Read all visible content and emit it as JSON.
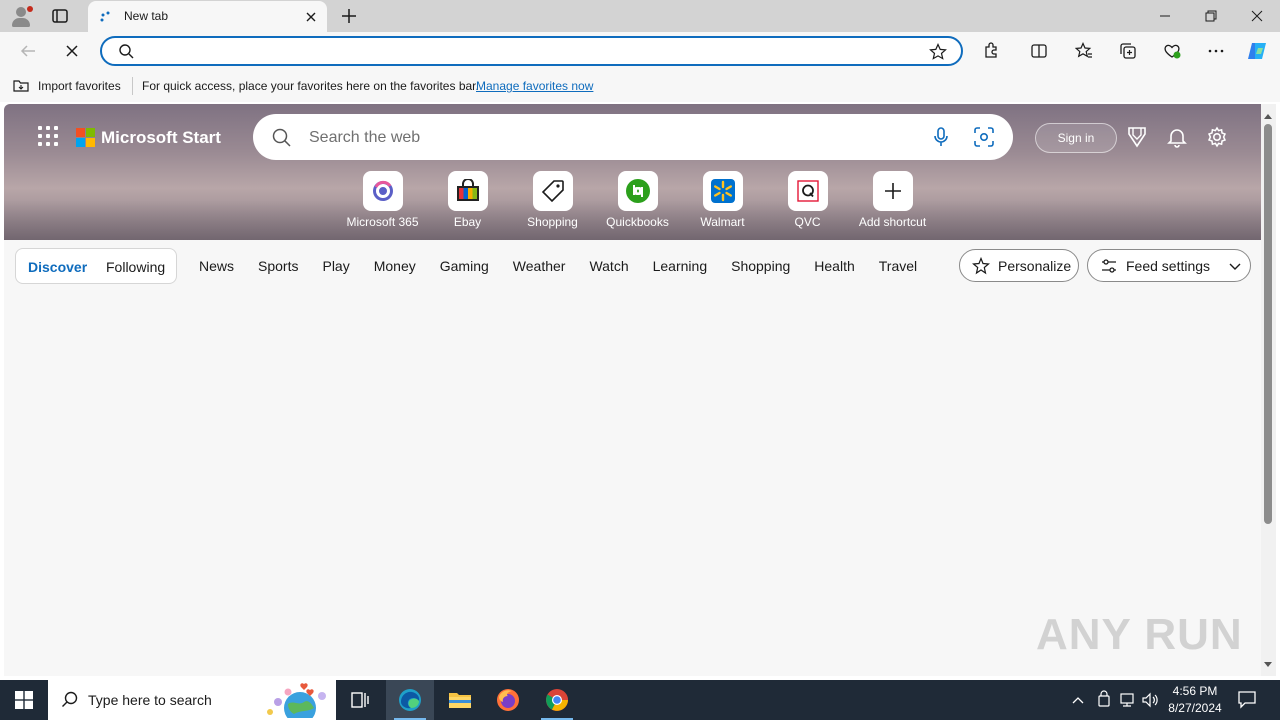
{
  "browser": {
    "tab_title": "New tab",
    "address_value": "",
    "favorites_bar": {
      "import_label": "Import favorites",
      "message": "For quick access, place your favorites here on the favorites bar.",
      "manage_link": "Manage favorites now"
    }
  },
  "msn": {
    "brand": "Microsoft Start",
    "search_placeholder": "Search the web",
    "signin_label": "Sign in",
    "shortcuts": [
      {
        "label": "Microsoft 365"
      },
      {
        "label": "Ebay"
      },
      {
        "label": "Shopping"
      },
      {
        "label": "Quickbooks"
      },
      {
        "label": "Walmart"
      },
      {
        "label": "QVC"
      },
      {
        "label": "Add shortcut"
      }
    ],
    "feed_tabs": {
      "discover": "Discover",
      "following": "Following"
    },
    "categories": [
      "News",
      "Sports",
      "Play",
      "Money",
      "Gaming",
      "Weather",
      "Watch",
      "Learning",
      "Shopping",
      "Health",
      "Travel"
    ],
    "personalize_label": "Personalize",
    "feed_settings_label": "Feed settings"
  },
  "watermark": {
    "text": "ANY RUN"
  },
  "taskbar": {
    "search_placeholder": "Type here to search",
    "time": "4:56 PM",
    "date": "8/27/2024"
  },
  "colors": {
    "accent": "#0f6cbd",
    "taskbar": "#1f2a37",
    "qb_green": "#2ca01c",
    "walmart_blue": "#0071ce",
    "walmart_yellow": "#ffc220"
  }
}
